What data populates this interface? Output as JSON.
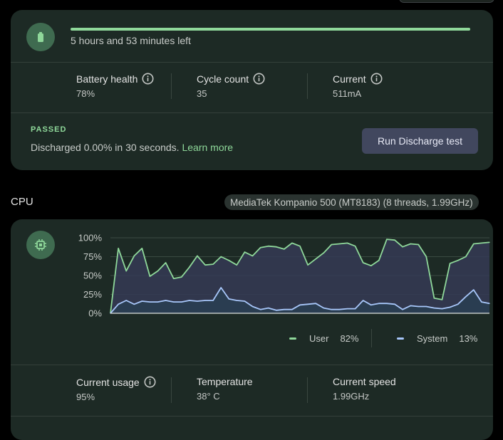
{
  "battery": {
    "progress_percent": 100,
    "time_left": "5 hours and 53 minutes left",
    "stats": [
      {
        "label": "Battery health",
        "value": "78%"
      },
      {
        "label": "Cycle count",
        "value": "35"
      },
      {
        "label": "Current",
        "value": "511mA"
      }
    ],
    "status": "PASSED",
    "discharge_text": "Discharged 0.00% in 30 seconds.",
    "learn_more": "Learn more",
    "run_button": "Run Discharge test"
  },
  "cpu": {
    "title": "CPU",
    "chip": "MediaTek Kompanio 500 (MT8183) (8 threads, 1.99GHz)",
    "legend": [
      {
        "name": "User",
        "value": "82%"
      },
      {
        "name": "System",
        "value": "13%"
      }
    ],
    "stats": [
      {
        "label": "Current usage",
        "value": "95%"
      },
      {
        "label": "Temperature",
        "value": "38° C"
      },
      {
        "label": "Current speed",
        "value": "1.99GHz"
      }
    ]
  },
  "colors": {
    "user": "#8fd89a",
    "system": "#a8c7fa",
    "user_fill": "#353a55",
    "system_fill": "#2a3e52",
    "grid": "#3a4a42"
  },
  "chart_data": {
    "type": "area",
    "y_ticks": [
      "100%",
      "75%",
      "50%",
      "25%",
      "0%"
    ],
    "ylim": [
      0,
      100
    ],
    "grid": true,
    "legend_position": "bottom-right",
    "series": [
      {
        "name": "User",
        "values": [
          0,
          86,
          56,
          76,
          86,
          49,
          56,
          67,
          46,
          48,
          61,
          76,
          64,
          65,
          75,
          70,
          64,
          81,
          76,
          87,
          89,
          88,
          85,
          93,
          89,
          64,
          72,
          80,
          91,
          92,
          93,
          89,
          67,
          63,
          70,
          98,
          97,
          88,
          92,
          91,
          75,
          20,
          18,
          66,
          70,
          75,
          92,
          93,
          94
        ]
      },
      {
        "name": "System",
        "values": [
          0,
          12,
          17,
          12,
          16,
          15,
          15,
          17,
          15,
          15,
          17,
          16,
          17,
          17,
          34,
          19,
          17,
          16,
          9,
          5,
          7,
          4,
          5,
          5,
          11,
          12,
          13,
          7,
          5,
          5,
          6,
          6,
          17,
          11,
          13,
          13,
          12,
          5,
          10,
          9,
          9,
          7,
          6,
          8,
          12,
          22,
          31,
          15,
          13
        ]
      }
    ]
  }
}
